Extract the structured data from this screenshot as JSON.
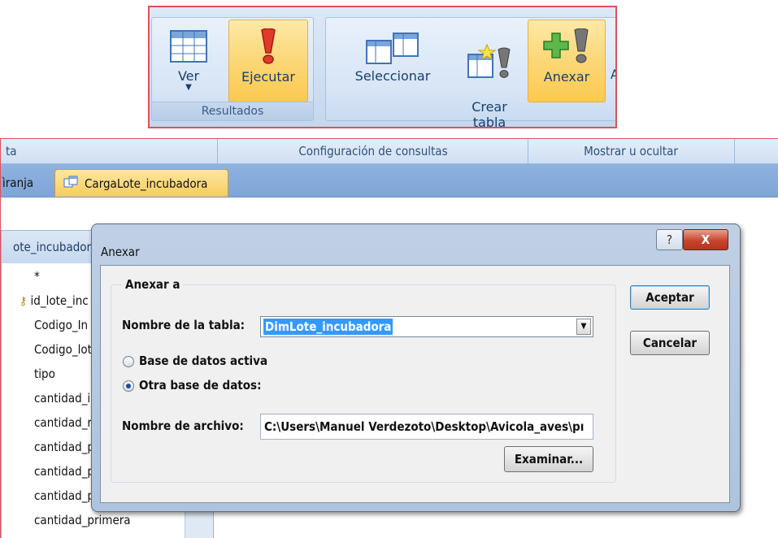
{
  "ribbon": {
    "results_group_label": "Resultados",
    "buttons": [
      {
        "id": "ver",
        "label": "Ver",
        "icon": "datasheet-view-icon"
      },
      {
        "id": "ejecutar",
        "label": "Ejecutar",
        "icon": "run-exclamation-icon",
        "active": true
      },
      {
        "id": "seleccionar",
        "label": "Seleccionar",
        "icon": "select-query-icon"
      },
      {
        "id": "crear",
        "label": "Crear\ntabla",
        "icon": "make-table-icon"
      },
      {
        "id": "anexar",
        "label": "Anexar",
        "icon": "append-query-icon",
        "active": true
      }
    ]
  },
  "group_bar": {
    "left_fragment": "ta",
    "center": "Configuración de consultas",
    "right": "Mostrar u ocultar"
  },
  "tabs": [
    {
      "label": "ìranja"
    },
    {
      "label": "CargaLote_incubadora",
      "active": true
    }
  ],
  "field_list": {
    "title": "ote_incubador",
    "fields": [
      "*",
      "id_lote_inc",
      "Codigo_In",
      "Codigo_lot",
      "tipo",
      "cantidad_i",
      "cantidad_r",
      "cantidad_p",
      "cantidad_p",
      "cantidad_perdida_tardia",
      "cantidad_primera"
    ]
  },
  "dialog": {
    "title": "Anexar",
    "help": "?",
    "close": "X",
    "group_label": "Anexar a",
    "table_name_label": "Nombre de la tabla:",
    "table_name_value": "DimLote_incubadora",
    "radio_current": "Base de datos activa",
    "radio_other": "Otra base de datos:",
    "radio_selected": "other",
    "file_name_label": "Nombre de archivo:",
    "file_name_value": "C:\\Users\\Manuel Verdezoto\\Desktop\\Avicola_aves\\pı",
    "ok": "Aceptar",
    "cancel": "Cancelar",
    "browse": "Examinar..."
  },
  "colors": {
    "accent_tab": "#f9cc5c",
    "ribbon_bg": "#d7e5f6",
    "selection": "#3399ff",
    "crop_border": "#e0505a"
  }
}
